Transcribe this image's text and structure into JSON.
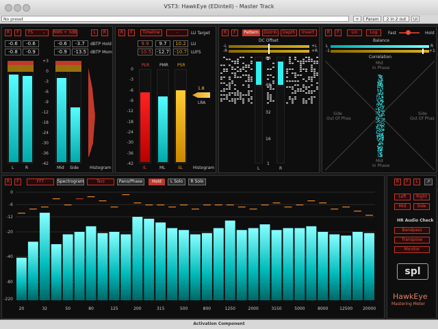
{
  "window": {
    "title": "VST3: HawkEye (EDintell) - Master Track"
  },
  "toolbar": {
    "preset": "No preset",
    "plus": "+",
    "param": "Param",
    "io": "2 in 2 out",
    "ui": "UI"
  },
  "true_peak": {
    "buttons": {
      "r": "R",
      "f": "F",
      "fs": "FS",
      "rms": "RMS + 3dB",
      "l": "L",
      "r2": "R"
    },
    "hold_label": "dBTP Hold",
    "mom_label": "dBTP Mom",
    "hold_values": [
      "-0.6",
      "-0.6",
      "-0.6",
      "-3.7"
    ],
    "mom_values": [
      "-0.8",
      "-0.9",
      "-0.9",
      "-13.5"
    ],
    "scale": [
      "+3",
      "0",
      "-3",
      "-6",
      "-9",
      "-12",
      "-18",
      "-24",
      "-30",
      "-36",
      "-42"
    ],
    "labels": {
      "l": "L",
      "r": "R",
      "mid": "Mid",
      "side": "Side",
      "hist": "Histogram"
    },
    "levels": [
      0.88,
      0.86,
      0.84,
      0.55
    ]
  },
  "loudness": {
    "buttons": {
      "r": "R",
      "f": "F",
      "timeline": "Timeline",
      "target_sel": "-",
      "target": "LU Target"
    },
    "headers": {
      "plr": "PLR",
      "pmr": "PMR",
      "psr": "PSR"
    },
    "row1": [
      "9.9",
      "9.7",
      "10.2"
    ],
    "row1_unit": "LU",
    "row2": [
      "-10.5",
      "-12.7",
      "-10.7"
    ],
    "row2_unit": "LUFS",
    "scale": [
      "0",
      "-3",
      "-6",
      "-9",
      "-12",
      "-18",
      "-24",
      "-30",
      "-36",
      "-42"
    ],
    "labels": {
      "il": "IL",
      "ml": "ML",
      "sl": "SL",
      "hist": "Histogram"
    },
    "lra_value": "1.8",
    "lra_label": "LRA",
    "levels": [
      0.76,
      0.72,
      0.78
    ]
  },
  "dc_offset": {
    "buttons": {
      "r": "R",
      "f": "F",
      "pattern": "Pattern",
      "distrib": "Distrib",
      "depth": "Depth",
      "invert": "Invert"
    },
    "title": "DC Offset",
    "scale": [
      "64",
      "48",
      "32",
      "16",
      "1"
    ],
    "lr": [
      "-L",
      "+L",
      "-R",
      "+R"
    ],
    "labels": {
      "l": "L",
      "r": "R"
    }
  },
  "correlation": {
    "buttons": {
      "r": "R",
      "f": "F",
      "lin": "Lin",
      "log": "Log",
      "fast": "Fast",
      "hold": "Hold"
    },
    "balance": "Balance",
    "correlation": "Correlation",
    "scale_l": "L",
    "scale_r": "R",
    "minus1": "-1",
    "plus1": "+1",
    "mid_top": "Mid",
    "in_phase_top": "In Phase",
    "side_left": "Side",
    "out_left": "Out Of Phas",
    "side_right": "Side",
    "out_right": "Out Of Phas",
    "mid_bottom": "Mid",
    "in_phase_bottom": "In Phase"
  },
  "spectrum": {
    "buttons": {
      "r": "R",
      "f": "F",
      "fft": "FFT",
      "spectrogram": "Spectrogram",
      "terz": "Terz",
      "pano": "Pano/Phase",
      "hold": "Hold",
      "lsolo": "L Solo",
      "rsolo": "R Solo"
    },
    "yscale": [
      "0",
      "-6",
      "-12",
      "-20",
      "-40",
      "-80",
      "-220"
    ],
    "xlabels": [
      "20",
      "32",
      "50",
      "80",
      "125",
      "200",
      "315",
      "500",
      "800",
      "1250",
      "2000",
      "3150",
      "5000",
      "8000",
      "12500",
      "20000"
    ],
    "footer": "Activation Component",
    "chart_data": {
      "type": "bar",
      "bands": 31,
      "values": [
        -42,
        -28,
        -10,
        -30,
        -22,
        -20,
        -17,
        -21,
        -20,
        -22,
        -12,
        -13,
        -15,
        -18,
        -19,
        -22,
        -21,
        -18,
        -14,
        -19,
        -18,
        -16,
        -19,
        -18,
        -18,
        -17,
        -20,
        -22,
        -23,
        -20,
        -21
      ],
      "peaks": [
        -10,
        -8,
        -7,
        -3,
        -6,
        -3,
        -2,
        -4,
        -7,
        -1,
        -5,
        -6,
        -6,
        -7,
        -6,
        -8,
        -6,
        -6,
        -6,
        -7,
        -8,
        -6,
        -5,
        -7,
        -6,
        -4,
        -5,
        -8,
        -7,
        -9,
        -11
      ],
      "ylim": [
        -220,
        6
      ]
    }
  },
  "side_panel": {
    "buttons": {
      "r": "R",
      "f": "F",
      "l": "L",
      "expand": "↗"
    },
    "left": "Left",
    "right": "Right",
    "mid": "Mid",
    "side": "Side",
    "hr_title": "HR Audio Check",
    "bandpass": "Bandpass",
    "transpose": "Transpose",
    "monitor": "Monitor",
    "brand": "spl",
    "product": "HawkEye",
    "product_sub": "Mastering Meter"
  }
}
